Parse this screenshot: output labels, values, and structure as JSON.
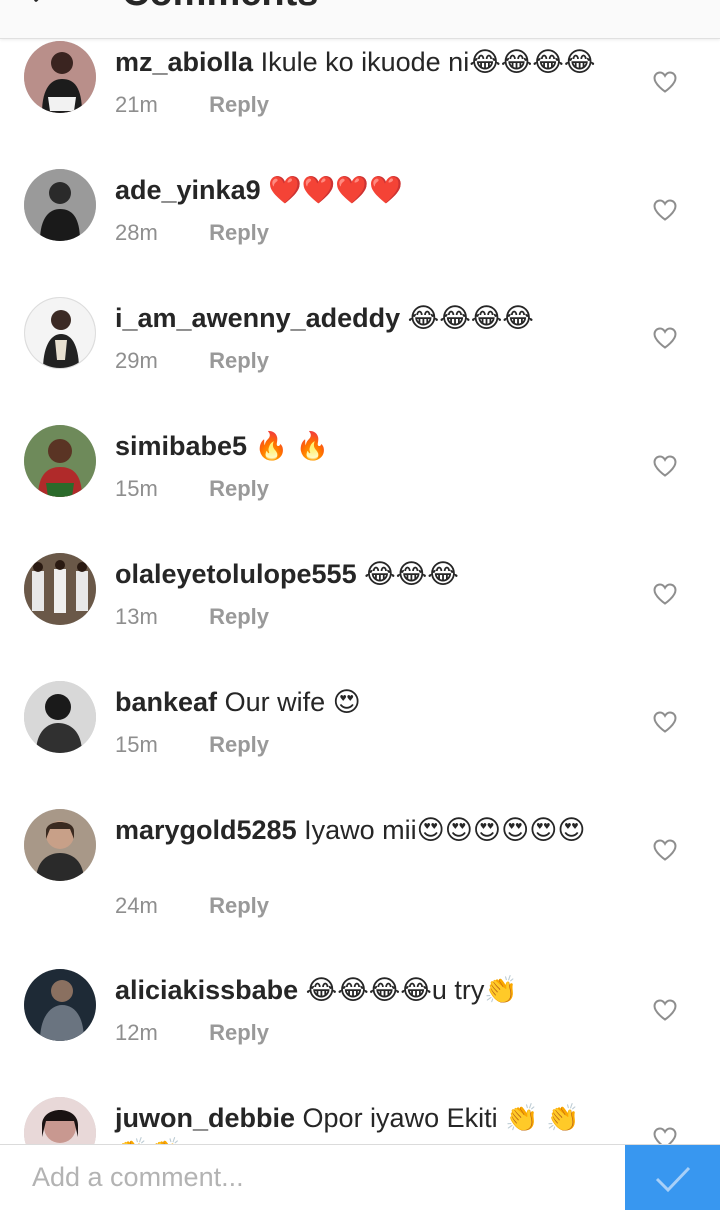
{
  "header": {
    "title": "Comments"
  },
  "comments": [
    {
      "username": "mz_abiolla",
      "text": "Ikule ko ikuode ni😂😂😂😂",
      "time": "21m",
      "reply": "Reply"
    },
    {
      "username": "ade_yinka9",
      "text": "❤️❤️❤️❤️",
      "time": "28m",
      "reply": "Reply"
    },
    {
      "username": "i_am_awenny_adeddy",
      "text": "😂😂😂😂",
      "time": "29m",
      "reply": "Reply"
    },
    {
      "username": "simibabe5",
      "text": "🔥 🔥",
      "time": "15m",
      "reply": "Reply"
    },
    {
      "username": "olaleyetolulope555",
      "text": "😂😂😂",
      "time": "13m",
      "reply": "Reply"
    },
    {
      "username": "bankeaf",
      "text": "Our wife 😍",
      "time": "15m",
      "reply": "Reply"
    },
    {
      "username": "marygold5285",
      "text": "Iyawo mii😍😍😍😍😍😍",
      "time": "24m",
      "reply": "Reply"
    },
    {
      "username": "aliciakissbabe",
      "text": "😂😂😂😂u try👏",
      "time": "12m",
      "reply": "Reply"
    },
    {
      "username": "juwon_debbie",
      "text": "Opor iyawo Ekiti 👏 👏 👏👏",
      "time": "",
      "reply": ""
    }
  ],
  "footer": {
    "placeholder": "Add a comment..."
  },
  "colors": {
    "accent": "#3897f0",
    "text": "#262626",
    "muted": "#8e8e8e"
  },
  "icons": {
    "back": "back-arrow-icon",
    "like": "heart-outline-icon",
    "send": "check-icon"
  }
}
